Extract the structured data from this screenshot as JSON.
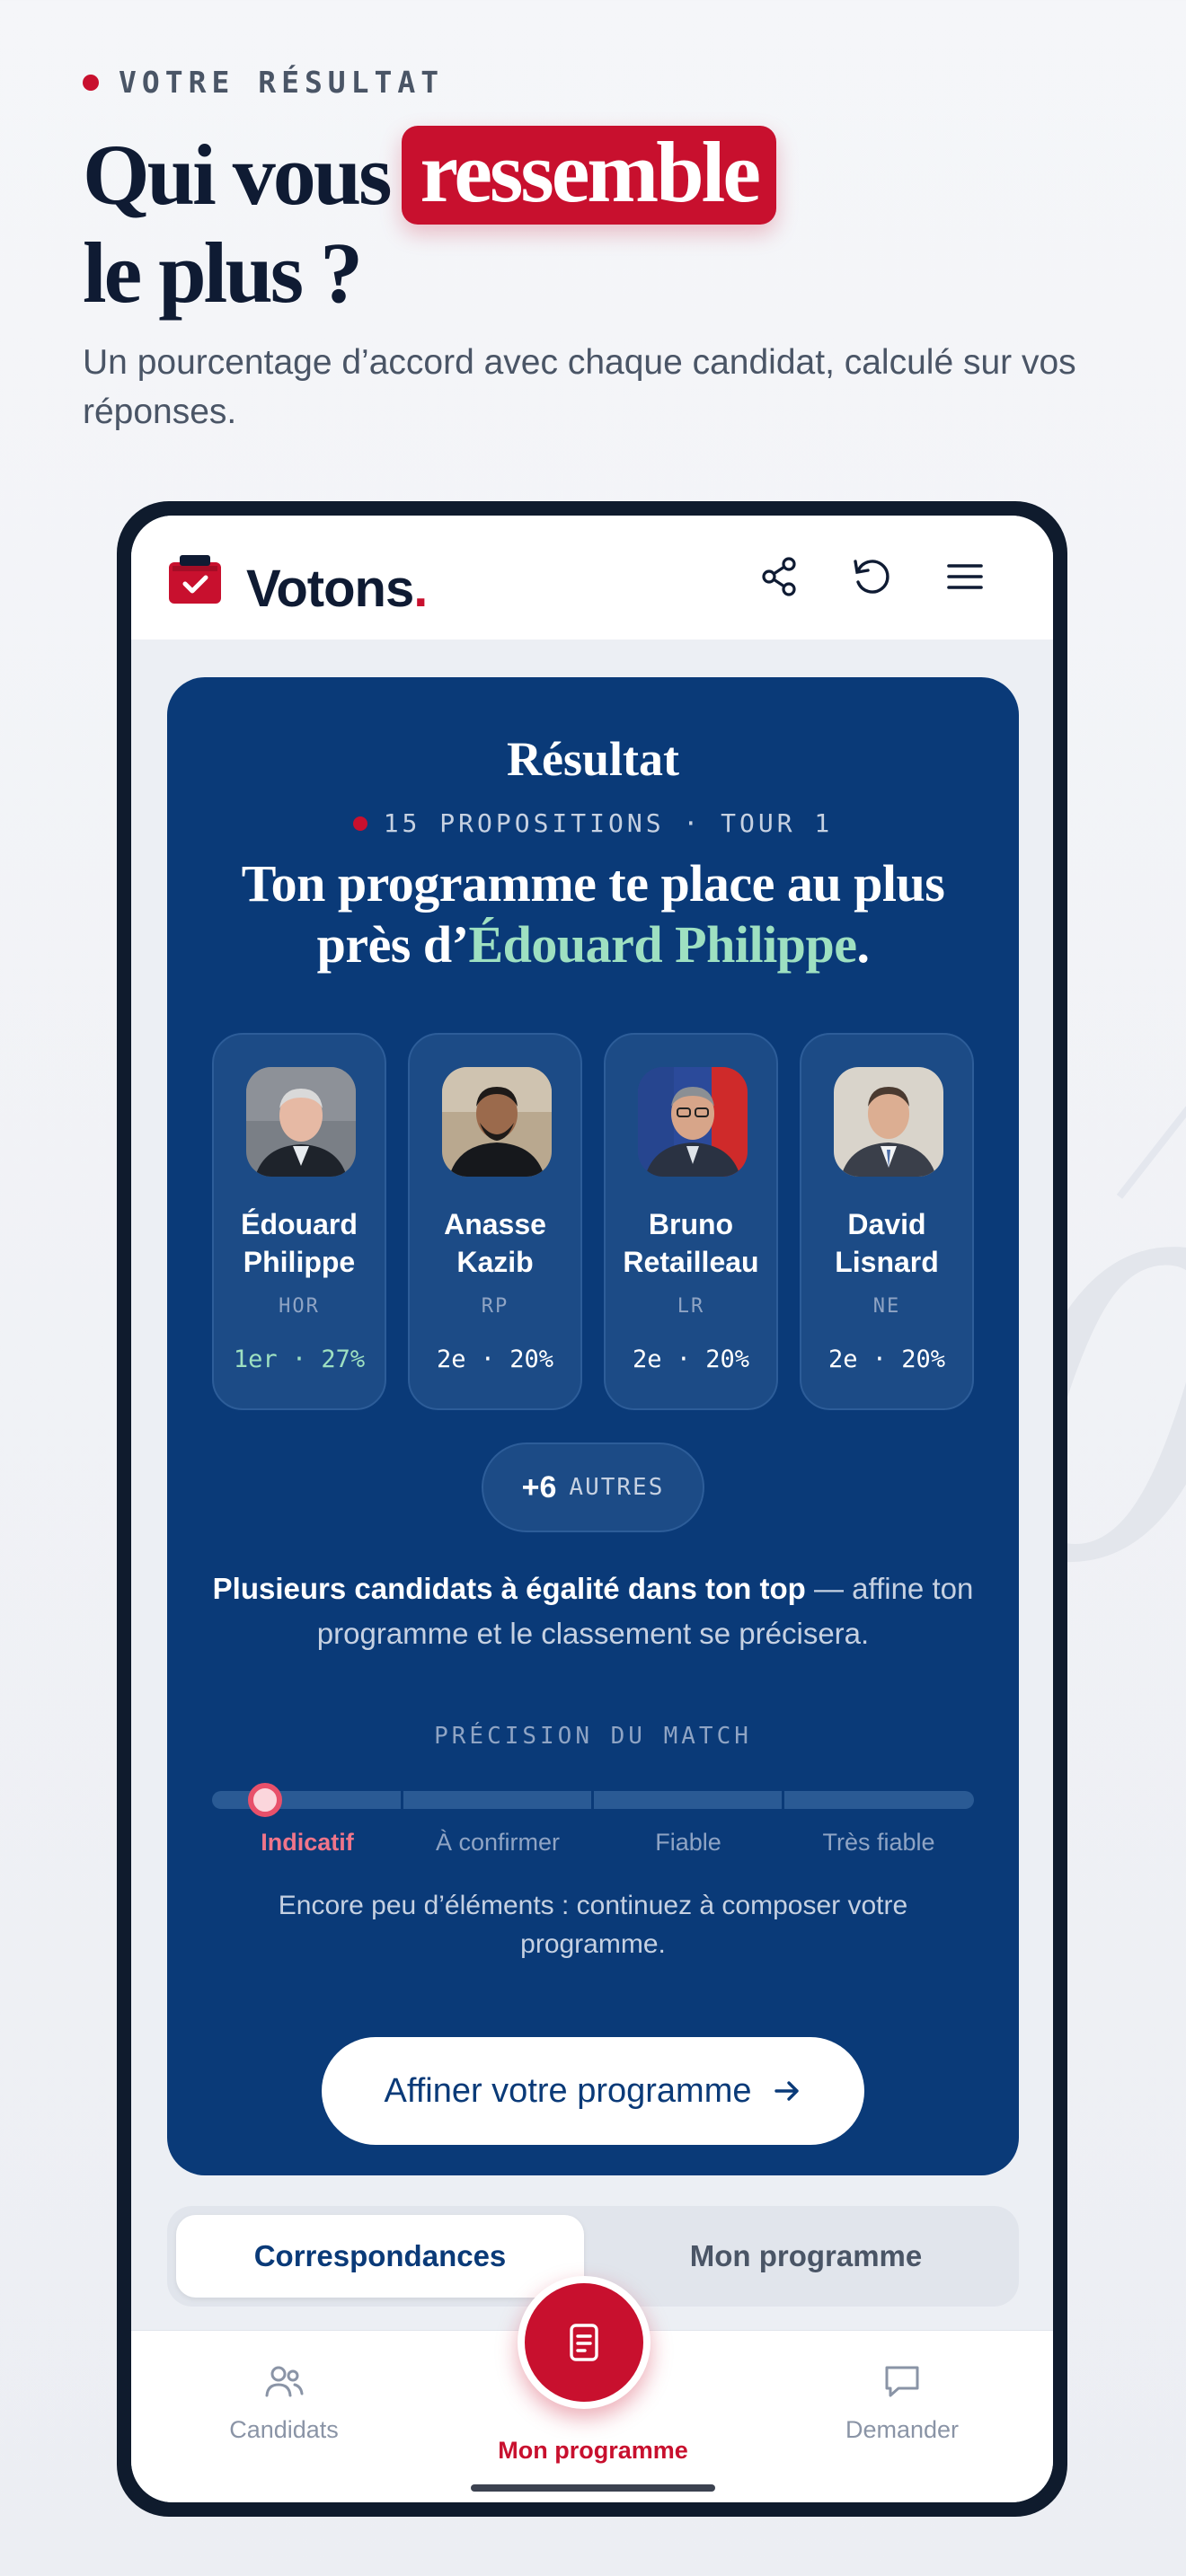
{
  "header": {
    "eyebrow": "VOTRE RÉSULTAT",
    "headline_part1": "Qui vous",
    "headline_highlight": "ressemble",
    "headline_part2": "le plus ?",
    "subtitle": "Un pourcentage d’accord avec chaque candidat, calculé sur vos réponses."
  },
  "app": {
    "brand": "Votons",
    "brand_dot": ".",
    "icons": [
      "share-icon",
      "refresh-icon",
      "menu-icon"
    ]
  },
  "result": {
    "title": "Résultat",
    "meta": "15 PROPOSITIONS · TOUR 1",
    "headline_prefix": "Ton programme te place au plus près d’",
    "headline_name": "Édouard Philippe",
    "headline_suffix": ".",
    "candidates": [
      {
        "name": "Édouard Philippe",
        "party": "HOR",
        "rank": "1er · 27%"
      },
      {
        "name": "Anasse Kazib",
        "party": "RP",
        "rank": "2e · 20%"
      },
      {
        "name": "Bruno Retailleau",
        "party": "LR",
        "rank": "2e · 20%"
      },
      {
        "name": "David Lisnard",
        "party": "NE",
        "rank": "2e · 20%"
      }
    ],
    "more_count": "+6",
    "more_label": "AUTRES",
    "tie_bold": "Plusieurs candidats à égalité dans ton top",
    "tie_rest": " — affine ton programme et le classement se précisera.",
    "precision_label": "PRÉCISION DU MATCH",
    "precision_steps": [
      "Indicatif",
      "À confirmer",
      "Fiable",
      "Très fiable"
    ],
    "precision_level": 0.07,
    "precision_text": "Encore peu d’éléments : continuez à composer votre programme.",
    "cta": "Affiner votre programme"
  },
  "segmented": {
    "tab1": "Correspondances",
    "tab2": "Mon programme"
  },
  "bottom_nav": {
    "items": [
      {
        "label": "Candidats",
        "icon": "users-icon"
      },
      {
        "label": "Mon programme",
        "icon": "document-icon"
      },
      {
        "label": "Demander",
        "icon": "chat-icon"
      }
    ]
  },
  "colors": {
    "brand_red": "#c8102e",
    "navy": "#0a3a78",
    "accent_green": "#9ee0c1"
  }
}
